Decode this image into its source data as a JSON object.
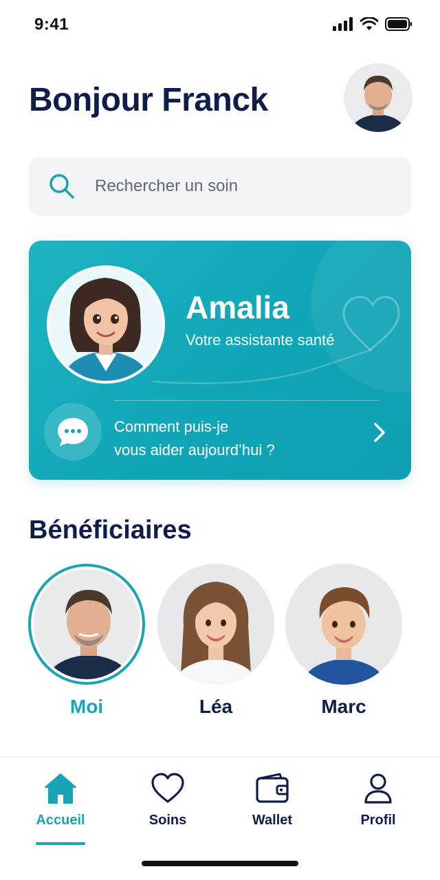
{
  "status_bar": {
    "time": "9:41"
  },
  "header": {
    "greeting": "Bonjour Franck"
  },
  "search": {
    "placeholder": "Rechercher un soin"
  },
  "assistant": {
    "name": "Amalia",
    "role": "Votre assistante santé",
    "prompt_line1": "Comment puis-je",
    "prompt_line2": "vous aider aujourd’hui ?"
  },
  "beneficiaries": {
    "title": "Bénéficiaires",
    "items": [
      {
        "name": "Moi",
        "selected": true
      },
      {
        "name": "Léa",
        "selected": false
      },
      {
        "name": "Marc",
        "selected": false
      }
    ]
  },
  "nav": {
    "items": [
      {
        "label": "Accueil",
        "icon": "home-icon",
        "active": true
      },
      {
        "label": "Soins",
        "icon": "heart-icon",
        "active": false
      },
      {
        "label": "Wallet",
        "icon": "wallet-icon",
        "active": false
      },
      {
        "label": "Profil",
        "icon": "user-icon",
        "active": false
      }
    ]
  },
  "colors": {
    "accent": "#1aa3b4",
    "card_gradient_start": "#1db3c0",
    "card_gradient_end": "#0ea0b2",
    "title_text": "#0f1d4a",
    "search_bg": "#f3f4f6"
  }
}
